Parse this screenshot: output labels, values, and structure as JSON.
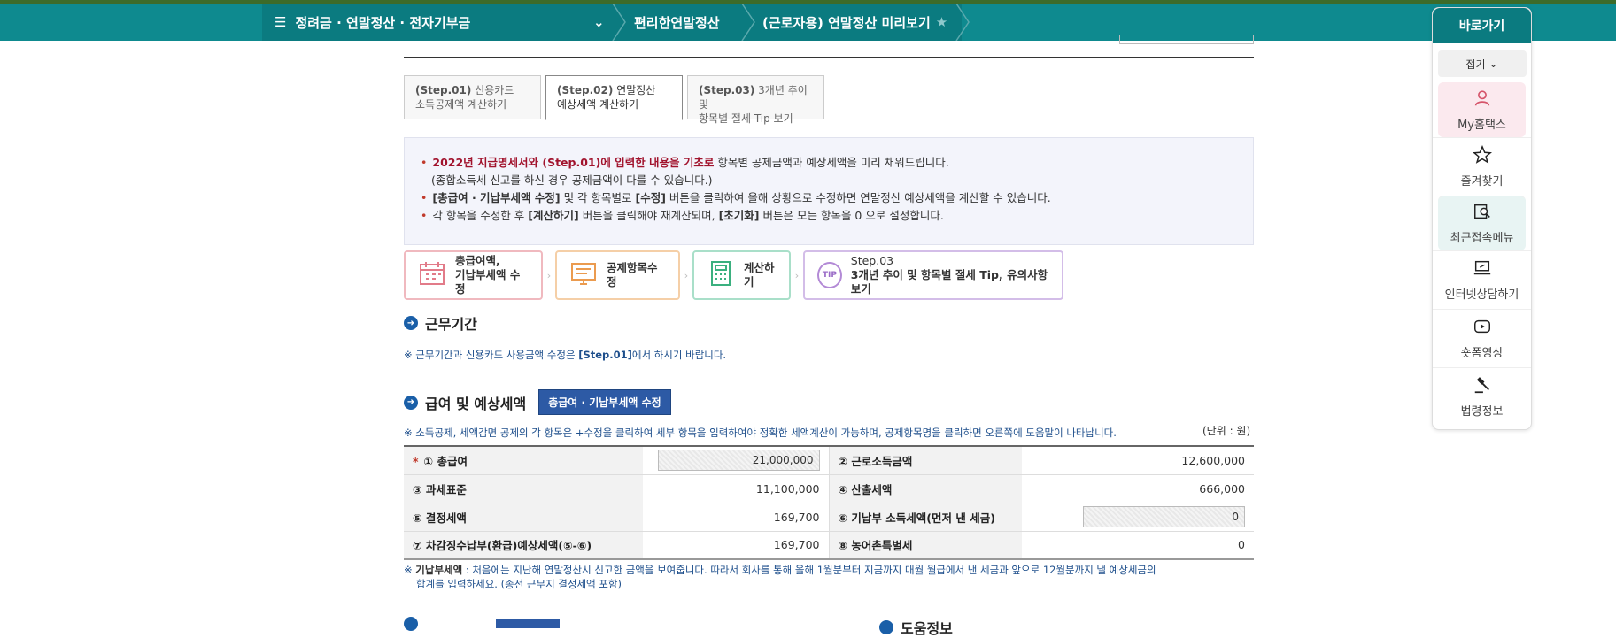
{
  "nav": {
    "menu": "정려금 · 연말정산 · 전자기부금",
    "crumb1": "편리한연말정산",
    "crumb2": "(근로자용) 연말정산 미리보기"
  },
  "quick": {
    "title": "바로가기",
    "fold": "접기",
    "items": [
      {
        "label": "My홈택스",
        "icon": "person-icon"
      },
      {
        "label": "즐겨찾기",
        "icon": "star-icon"
      },
      {
        "label": "최근접속메뉴",
        "icon": "recent-search-icon"
      },
      {
        "label": "인터넷상담하기",
        "icon": "laptop-chat-icon"
      },
      {
        "label": "숏폼영상",
        "icon": "play-icon"
      },
      {
        "label": "법령정보",
        "icon": "gavel-icon"
      }
    ]
  },
  "tabs": [
    {
      "step": "(Step.01)",
      "line1": "신용카드",
      "line2": "소득공제액 계산하기"
    },
    {
      "step": "(Step.02)",
      "line1": "연말정산",
      "line2": "예상세액 계산하기"
    },
    {
      "step": "(Step.03)",
      "line1": "3개년 추이 및",
      "line2": "항목별 절세 Tip 보기"
    }
  ],
  "info": {
    "l1_red": "2022년 지급명세서와 (Step.01)에 입력한 내용을 기초로",
    "l1_rest": " 항목별 공제금액과 예상세액을 미리 채워드립니다.",
    "l1_sub": "(종합소득세 신고를 하신 경우 공제금액이 다를 수 있습니다.)",
    "l2_b1": "[총급여 · 기납부세액 수정]",
    "l2_m": " 및 각 항목별로 ",
    "l2_b2": "[수정]",
    "l2_rest": " 버튼을 클릭하여 올해 상황으로 수정하면 연말정산 예상세액을 계산할 수 있습니다.",
    "l3_a": "각 항목을 수정한 후 ",
    "l3_b1": "[계산하기]",
    "l3_m": " 버튼을 클릭해야 재계산되며, ",
    "l3_b2": "[초기화]",
    "l3_rest": " 버튼은 모든 항목을 0 으로 설정합니다."
  },
  "steps": {
    "s1a": "총급여액,",
    "s1b": "기납부세액 수정",
    "s2": "공제항목수정",
    "s3": "계산하기",
    "s4a": "Step.03",
    "s4b": "3개년 추이 및 항목별 절세 Tip, 유의사항보기",
    "tip": "TIP"
  },
  "work": {
    "title": "근무기간",
    "note_pre": "※ 근무기간과 신용카드 사용금액 수정은 ",
    "note_b": "[Step.01]",
    "note_post": "에서 하시기 바랍니다."
  },
  "pay": {
    "title": "급여 및 예상세액",
    "button": "총급여 · 기납부세액 수정",
    "note": "※ 소득공제, 세액감면 공제의 각 항목은 +수정을 클릭하여 세부 항목을 입력하여야 정확한 세액계산이 가능하며, 공제항목명을 클릭하면 오른쪽에 도움말이 나타납니다.",
    "unit": "(단위 : 원)",
    "rows": [
      {
        "l1": "① 총급여",
        "v1": "21,000,000",
        "l2": "② 근로소득금액",
        "v2": "12,600,000"
      },
      {
        "l1": "③ 과세표준",
        "v1": "11,100,000",
        "l2": "④ 산출세액",
        "v2": "666,000"
      },
      {
        "l1": "⑤ 결정세액",
        "v1": "169,700",
        "l2": "⑥ 기납부 소득세액(먼저 낸 세금)",
        "v2": "0"
      },
      {
        "l1": "⑦ 차감징수납부(환급)예상세액(⑤-⑥)",
        "v1": "169,700",
        "l2": "⑧ 농어촌특별세",
        "v2": "0"
      }
    ],
    "star": "*"
  },
  "foot": {
    "b": "기납부세액",
    "t1": " : 처음에는 지난해 연말정산시 신고한 금액을 보여줍니다. 따라서 회사를 통해 올해 1월분부터 지금까지 매월 월급에서 낸 세금과 앞으로 12월분까지 낼 예상세금의",
    "t2": "합계를 입력하세요. (종전 근무지 결정세액 포함)"
  },
  "cut": {
    "help": "도움정보"
  }
}
